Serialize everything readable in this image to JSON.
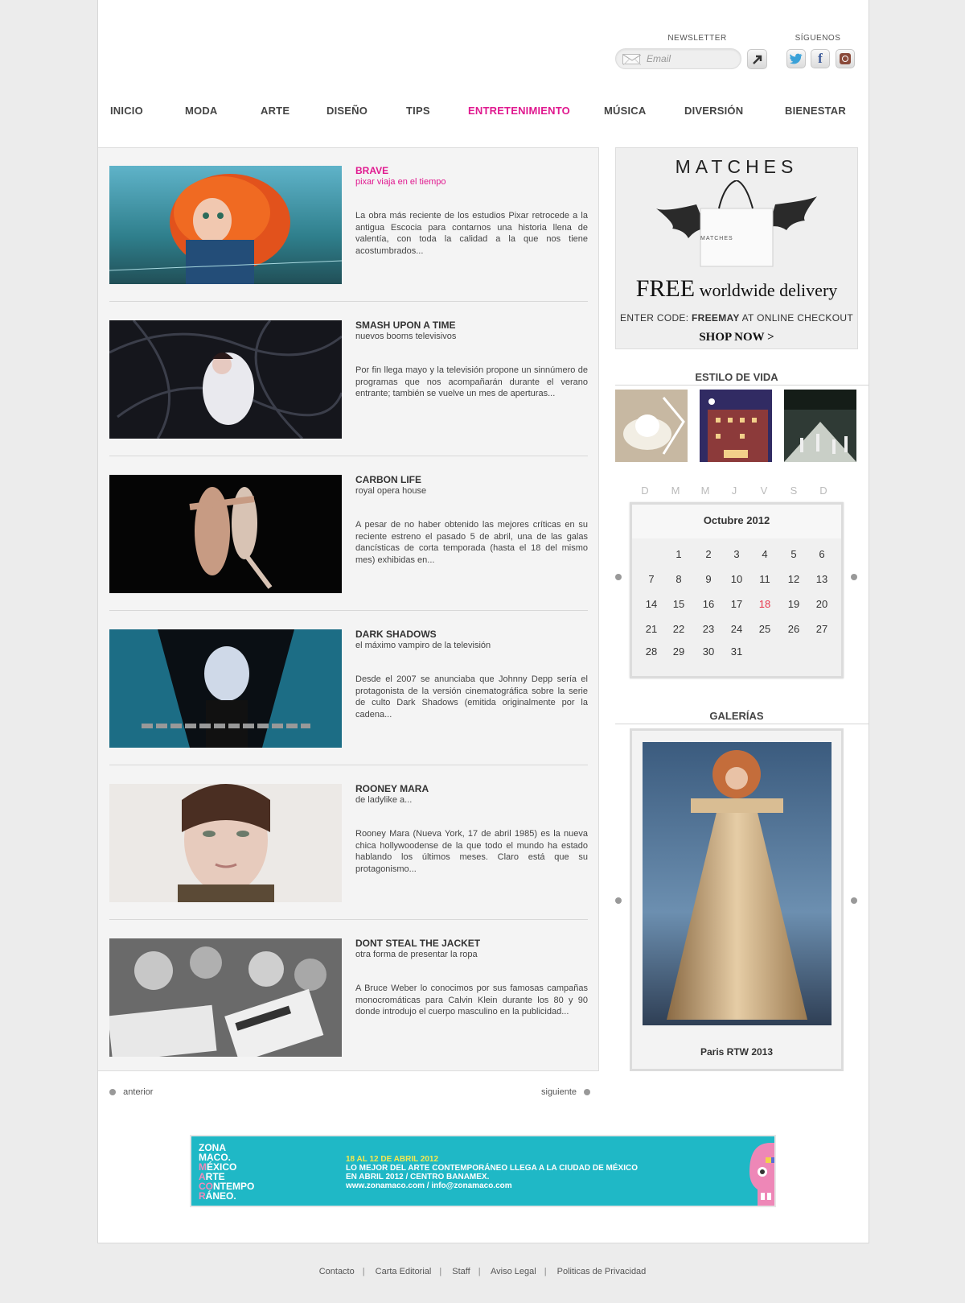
{
  "header": {
    "newsletter_label": "NEWSLETTER",
    "email_placeholder": "Email",
    "follow_label": "SÍGUENOS",
    "social": [
      "twitter-icon",
      "facebook-icon",
      "instagram-icon"
    ]
  },
  "nav": {
    "items": [
      {
        "label": "INICIO"
      },
      {
        "label": "MODA"
      },
      {
        "label": "ARTE"
      },
      {
        "label": "DISEÑO"
      },
      {
        "label": "TIPS"
      },
      {
        "label": "ENTRETENIMIENTO",
        "active": true
      },
      {
        "label": "MÚSICA"
      },
      {
        "label": "DIVERSIÓN"
      },
      {
        "label": "BIENESTAR"
      }
    ],
    "active_color": "#e0198f"
  },
  "articles": [
    {
      "title": "BRAVE",
      "subtitle": "pixar viaja en el tiempo",
      "description": "La obra más reciente de los estudios Pixar retrocede a la antigua Escocia para contarnos una historia llena de valentía, con toda la calidad a la que nos tiene acostumbrados..."
    },
    {
      "title": "SMASH UPON A TIME",
      "subtitle": "nuevos booms televisivos",
      "description": "Por fin llega mayo y la televisión propone un sinnúmero de programas que nos acompañarán durante el verano entrante; también se vuelve un mes de aperturas..."
    },
    {
      "title": "CARBON LIFE",
      "subtitle": "royal opera house",
      "description": "A pesar de no haber obtenido las mejores críticas en su reciente estreno el pasado 5 de abril, una de las galas dancísticas de corta temporada (hasta el 18 del mismo mes) exhibidas en..."
    },
    {
      "title": "DARK SHADOWS",
      "subtitle": "el máximo vampiro de la televisión",
      "description": "Desde el 2007 se anunciaba que Johnny Depp sería el protagonista de la versión cinematográfica sobre la serie de culto Dark Shadows (emitida originalmente por la cadena..."
    },
    {
      "title": "ROONEY MARA",
      "subtitle": "de ladylike a...",
      "description": "Rooney Mara (Nueva York, 17 de abril 1985) es la nueva chica hollywoodense de la que todo el mundo ha estado hablando los últimos meses. Claro está que su protagonismo..."
    },
    {
      "title": "DONT STEAL THE JACKET",
      "subtitle": "otra forma de presentar la ropa",
      "description": "A Bruce Weber lo conocimos por sus famosas campañas monocromáticas para Calvin Klein durante los 80 y 90 donde introdujo el cuerpo masculino en la publicidad..."
    }
  ],
  "pager": {
    "prev": "anterior",
    "next": "siguiente"
  },
  "ad": {
    "brand": "MATCHES",
    "bag_label": "MATCHES",
    "free_big": "FREE",
    "free_rest": " worldwide delivery",
    "code_prefix": "ENTER CODE: ",
    "code": "FREEMAY",
    "code_suffix": " AT ONLINE CHECKOUT",
    "cta": "SHOP NOW >"
  },
  "lifestyle": {
    "title": "ESTILO DE VIDA"
  },
  "calendar": {
    "weekdays": [
      "D",
      "M",
      "M",
      "J",
      "V",
      "S",
      "D"
    ],
    "month": "Octubre 2012",
    "weeks": [
      [
        "",
        "1",
        "2",
        "3",
        "4",
        "5",
        "6"
      ],
      [
        "7",
        "8",
        "9",
        "10",
        "11",
        "12",
        "13"
      ],
      [
        "14",
        "15",
        "16",
        "17",
        "18",
        "19",
        "20"
      ],
      [
        "21",
        "22",
        "23",
        "24",
        "25",
        "26",
        "27"
      ],
      [
        "28",
        "29",
        "30",
        "31",
        "",
        "",
        ""
      ]
    ],
    "today": "18",
    "today_color": "#e8344a"
  },
  "galleries": {
    "title": "GALERÍAS",
    "caption": "Paris RTW 2013"
  },
  "banner": {
    "logo_lines": [
      "ZONA",
      "MACO.",
      "MÉXICO",
      "ARTE",
      "CONTEMPO",
      "RÁNEO."
    ],
    "dates": "18 AL 12 DE ABRIL 2012",
    "line1": "LO MEJOR DEL ARTE CONTEMPORÁNEO LLEGA A LA CIUDAD DE MÉXICO",
    "line2": "EN ABRIL 2012 / CENTRO BANAMEX.",
    "line3": "www.zonamaco.com / info@zonamaco.com",
    "color": "#1fb8c6"
  },
  "footer": {
    "links": [
      "Contacto",
      "Carta Editorial",
      "Staff",
      "Aviso Legal",
      "Politicas de Privacidad"
    ]
  }
}
